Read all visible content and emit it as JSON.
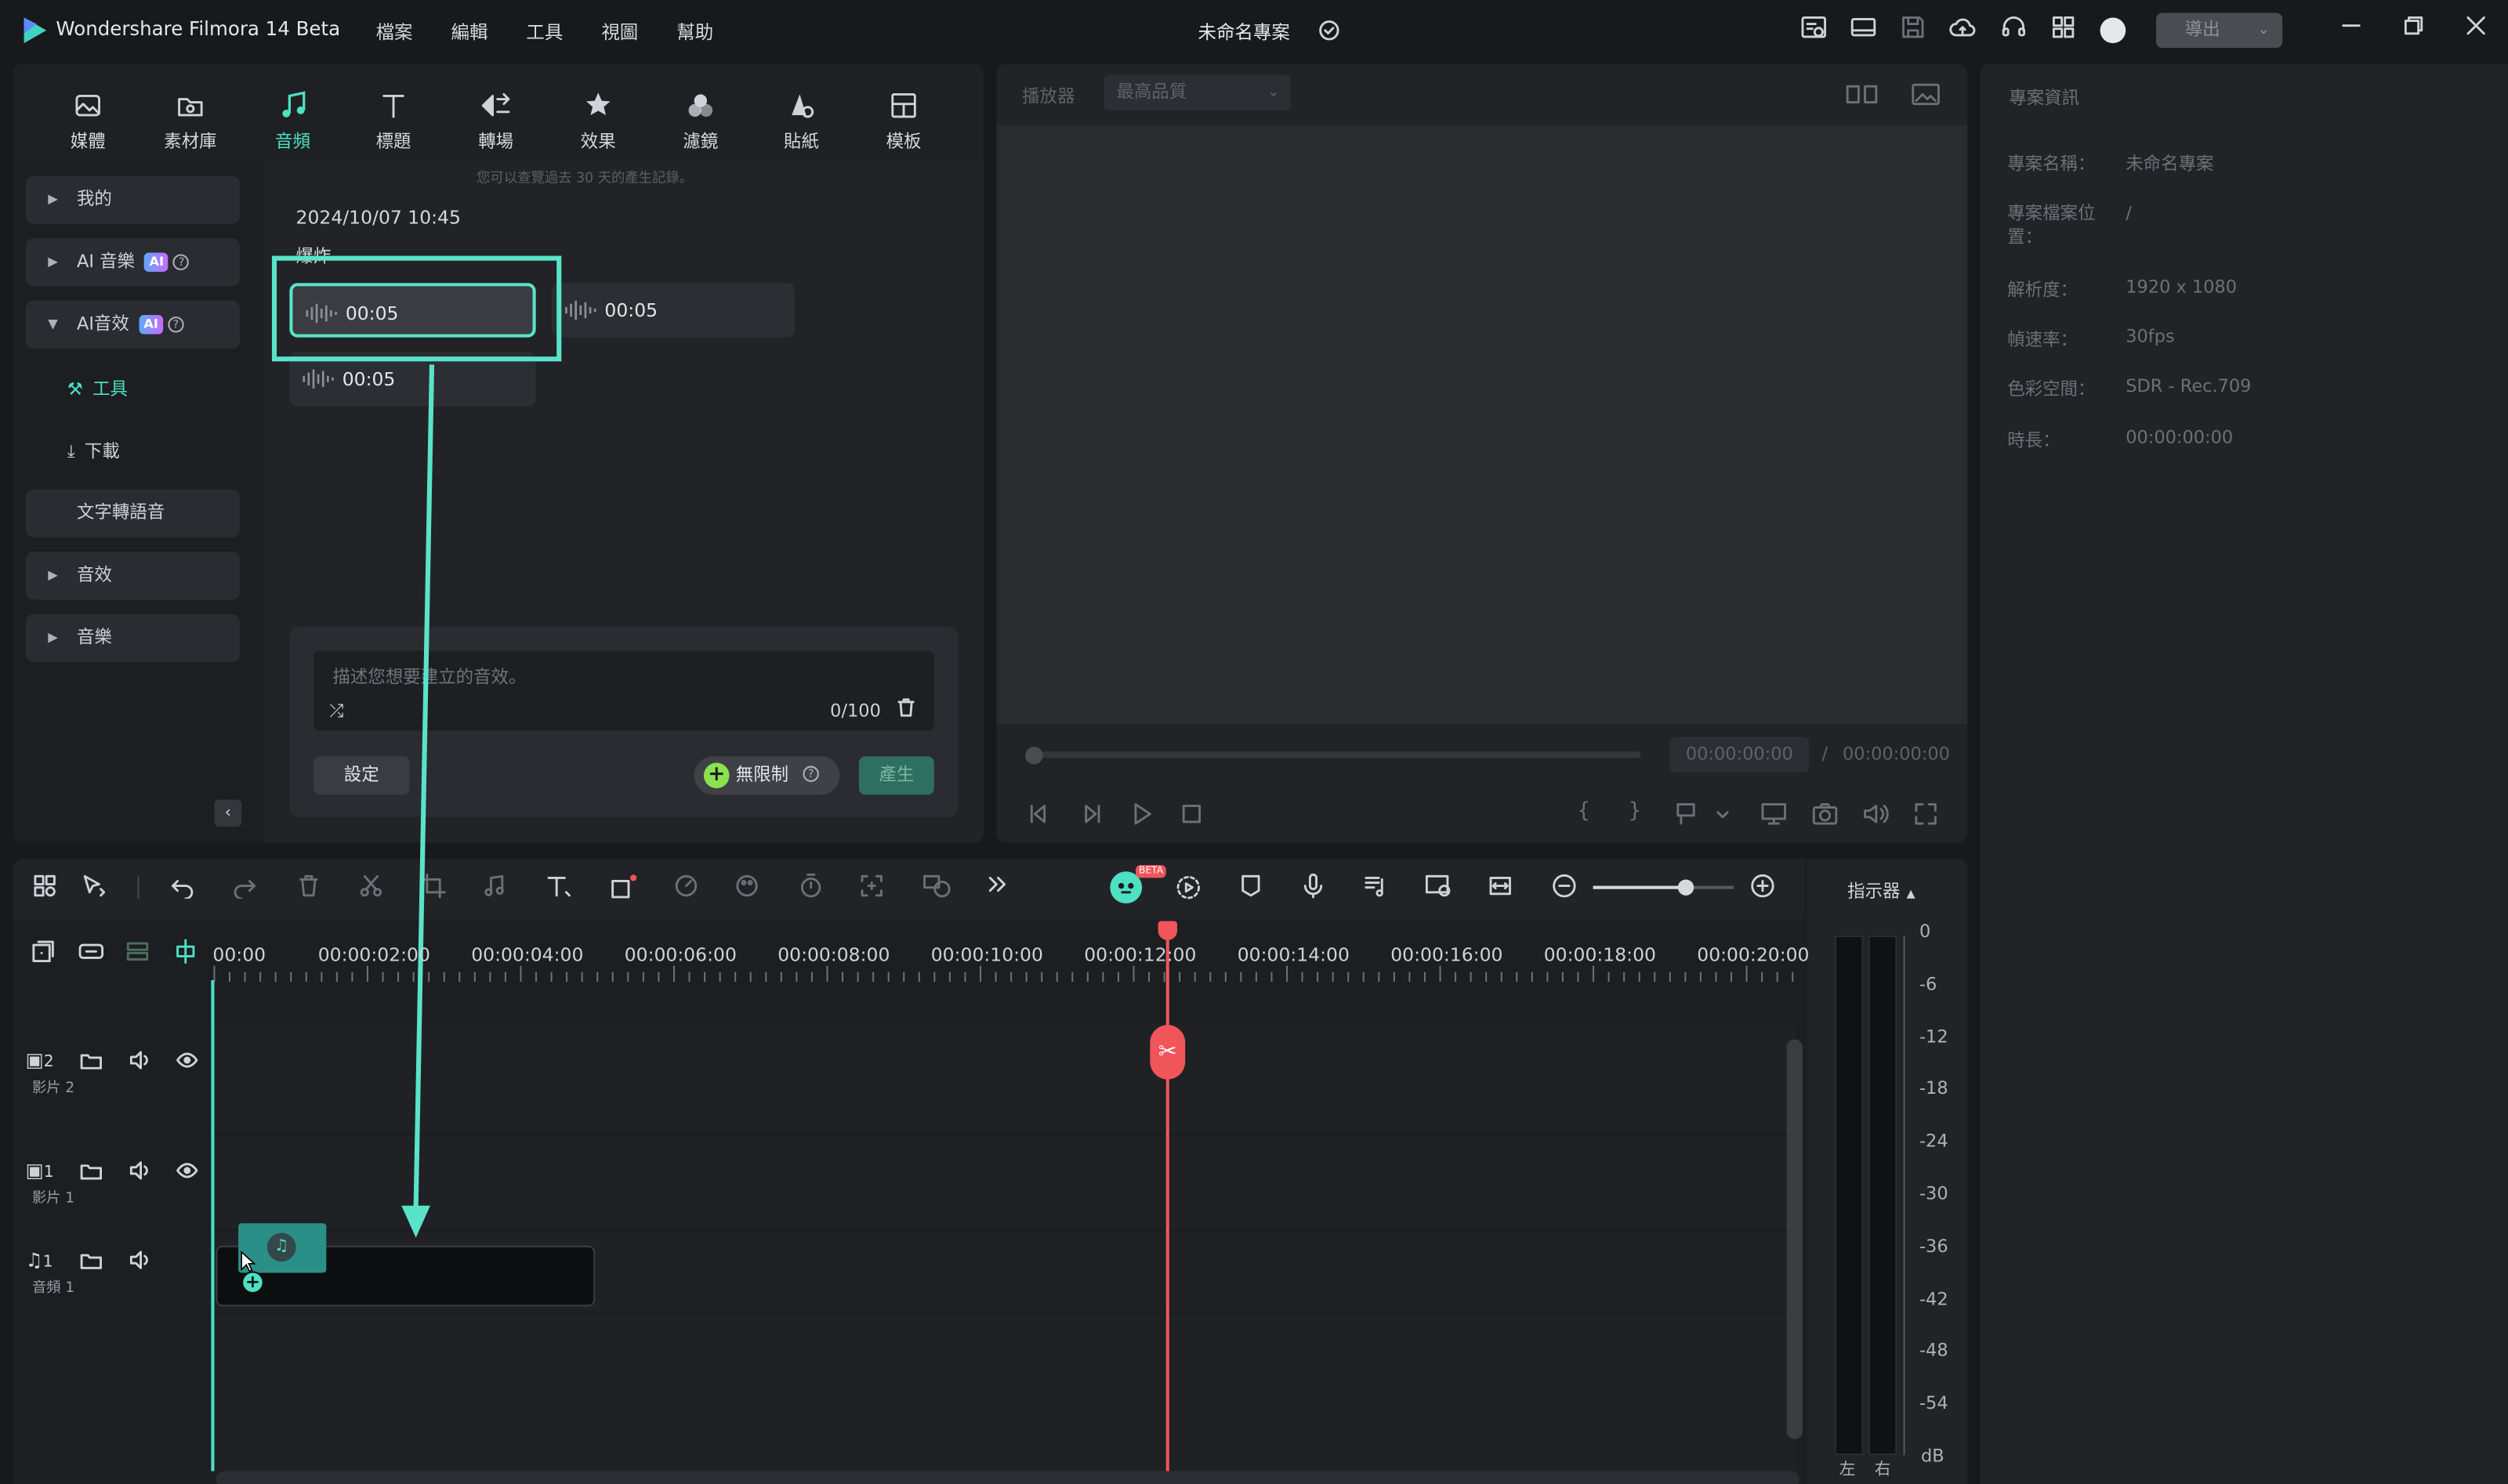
{
  "app": {
    "title": "Wondershare Filmora 14 Beta",
    "project_title": "未命名專案",
    "export_label": "導出"
  },
  "menu": [
    "檔案",
    "編輯",
    "工具",
    "視圖",
    "幫助"
  ],
  "tabs": [
    {
      "label": "媒體",
      "icon": "media-icon"
    },
    {
      "label": "素材庫",
      "icon": "library-icon"
    },
    {
      "label": "音頻",
      "icon": "music-note-icon"
    },
    {
      "label": "標題",
      "icon": "title-t-icon"
    },
    {
      "label": "轉場",
      "icon": "transition-icon"
    },
    {
      "label": "效果",
      "icon": "effects-star-icon"
    },
    {
      "label": "濾鏡",
      "icon": "filter-circles-icon"
    },
    {
      "label": "貼紙",
      "icon": "sticker-icon"
    },
    {
      "label": "模板",
      "icon": "template-icon"
    }
  ],
  "sidebar": {
    "items": [
      {
        "label": "我的"
      },
      {
        "label": "AI 音樂",
        "badge": "AI"
      },
      {
        "label": "AI音效",
        "badge": "AI"
      },
      {
        "label": "工具"
      },
      {
        "label": "下載"
      },
      {
        "label": "文字轉語音"
      },
      {
        "label": "音效"
      },
      {
        "label": "音樂"
      }
    ]
  },
  "audio_panel": {
    "notice": "您可以查覽過去 30 天的產生記錄。",
    "timestamp": "2024/10/07 10:45",
    "group_label": "爆炸",
    "clips": [
      "00:05",
      "00:05",
      "00:05"
    ],
    "prompt_placeholder": "描述您想要建立的音效。",
    "char_count": "0/100",
    "settings_label": "設定",
    "unlimited_label": "無限制",
    "generate_label": "產生"
  },
  "player": {
    "label": "播放器",
    "quality": "最高品質",
    "current_time": "00:00:00:00",
    "separator": "/",
    "total_time": "00:00:00:00"
  },
  "project_info": {
    "title": "專案資訊",
    "rows": [
      {
        "key": "專案名稱：",
        "value": "未命名專案"
      },
      {
        "key": "專案檔案位置：",
        "value": "/"
      },
      {
        "key": "解析度：",
        "value": "1920 x 1080"
      },
      {
        "key": "幀速率：",
        "value": "30fps"
      },
      {
        "key": "色彩空間：",
        "value": "SDR - Rec.709"
      },
      {
        "key": "時長：",
        "value": "00:00:00:00"
      }
    ]
  },
  "timeline": {
    "meter_label": "指示器",
    "ruler": [
      "00:00",
      "00:00:02:00",
      "00:00:04:00",
      "00:00:06:00",
      "00:00:08:00",
      "00:00:10:00",
      "00:00:12:00",
      "00:00:14:00",
      "00:00:16:00",
      "00:00:18:00",
      "00:00:20:00"
    ],
    "tracks": [
      {
        "num": "2",
        "name": "影片 2"
      },
      {
        "num": "1",
        "name": "影片 1"
      },
      {
        "num": "1",
        "name": "音頻 1"
      }
    ],
    "beta_badge": "BETA",
    "meter_scale": [
      "0",
      "-6",
      "-12",
      "-18",
      "-24",
      "-30",
      "-36",
      "-42",
      "-48",
      "-54",
      "dB"
    ],
    "meter_channels": [
      "左",
      "右"
    ]
  },
  "colors": {
    "accent": "#4de0c2",
    "playhead": "#f0555a",
    "highlight": "#59e3c8"
  }
}
